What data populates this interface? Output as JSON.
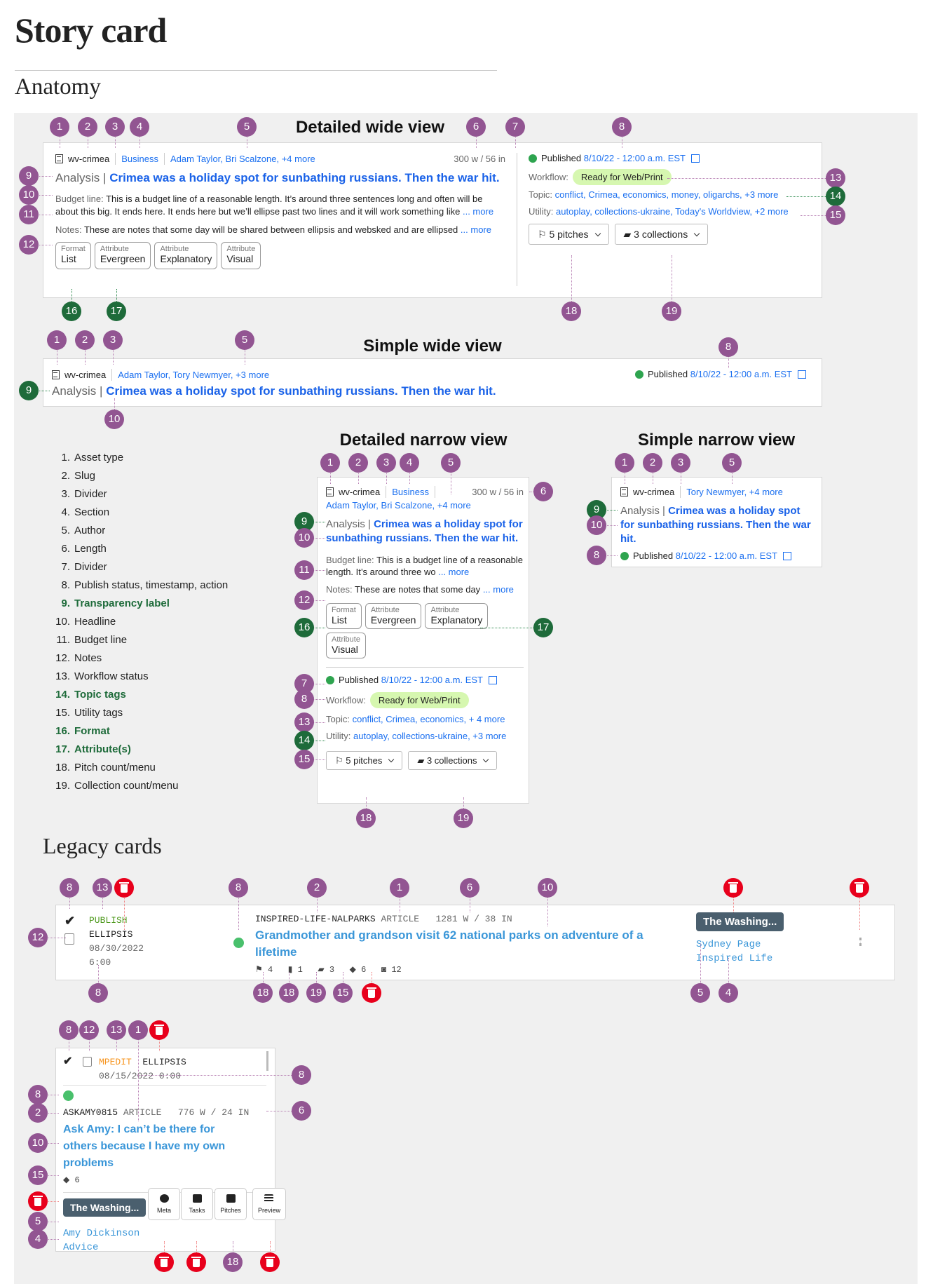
{
  "page": {
    "title": "Story card",
    "section_anatomy": "Anatomy",
    "section_legacy": "Legacy cards"
  },
  "colors": {
    "badge": "#925592",
    "badge_highlight": "#1e6b3a",
    "badge_delete": "#e8001c",
    "link": "#1a6ff0",
    "workflow_pill": "#d6f7b0",
    "published_dot": "#2ea44f"
  },
  "detailed_wide": {
    "heading": "Detailed wide view",
    "slug": "wv-crimea",
    "section": "Business",
    "authors": "Adam Taylor, Bri Scalzone, +4 more",
    "length": "300 w / 56 in",
    "label": "Analysis |",
    "headline": "Crimea was a holiday spot for sunbathing russians. Then the war hit.",
    "budget_label": "Budget line:",
    "budget_text": "This is a budget line of a reasonable length. It’s around three sentences long and often will be about this big. It ends here. It ends here but we’ll ellipse past two lines and it will work something like",
    "more": "... more",
    "notes_label": "Notes:",
    "notes_text": "These are notes that some day will be shared between ellipsis and websked and are ellipsed",
    "chips": [
      {
        "k": "Format",
        "v": "List"
      },
      {
        "k": "Attribute",
        "v": "Evergreen"
      },
      {
        "k": "Attribute",
        "v": "Explanatory"
      },
      {
        "k": "Attribute",
        "v": "Visual"
      }
    ],
    "status": "Published",
    "timestamp": "8/10/22 - 12:00 a.m. EST",
    "workflow_label": "Workflow:",
    "workflow": "Ready for Web/Print",
    "topic_label": "Topic:",
    "topics": "conflict, Crimea, economics, money, oligarchs, +3 more",
    "utility_label": "Utility:",
    "utilities": "autoplay, collections-ukraine, Today's Worldview, +2 more",
    "pitches": "5 pitches",
    "collections": "3 collections"
  },
  "simple_wide": {
    "heading": "Simple wide view",
    "slug": "wv-crimea",
    "authors": "Adam Taylor, Tory Newmyer, +3 more",
    "label": "Analysis |",
    "headline": "Crimea was a holiday spot for sunbathing russians. Then the war hit.",
    "status": "Published",
    "timestamp": "8/10/22 - 12:00 a.m. EST"
  },
  "detailed_narrow": {
    "heading": "Detailed narrow view",
    "slug": "wv-crimea",
    "section": "Business",
    "length": "300 w / 56 in",
    "authors": "Adam Taylor, Bri Scalzone, +4 more",
    "label": "Analysis |",
    "headline": "Crimea was a holiday spot for sunbathing russians. Then the war hit.",
    "budget_label": "Budget line:",
    "budget_text": "This is a budget line of a reasonable length. It’s around three wo",
    "more": "... more",
    "notes_label": "Notes:",
    "notes_text": "These are notes that some day",
    "chips": [
      {
        "k": "Format",
        "v": "List"
      },
      {
        "k": "Attribute",
        "v": "Evergreen"
      },
      {
        "k": "Attribute",
        "v": "Explanatory"
      },
      {
        "k": "Attribute",
        "v": "Visual"
      }
    ],
    "status": "Published",
    "timestamp": "8/10/22 - 12:00 a.m. EST",
    "workflow_label": "Workflow:",
    "workflow": "Ready for Web/Print",
    "topic_label": "Topic:",
    "topics": "conflict, Crimea, economics, + 4 more",
    "utility_label": "Utility:",
    "utilities": "autoplay, collections-ukraine, +3 more",
    "pitches": "5 pitches",
    "collections": "3 collections"
  },
  "simple_narrow": {
    "heading": "Simple narrow view",
    "slug": "wv-crimea",
    "authors": "Tory Newmyer, +4 more",
    "label": "Analysis |",
    "headline": "Crimea was a holiday spot for sunbathing russians. Then the war hit.",
    "status": "Published",
    "timestamp": "8/10/22 - 12:00 a.m. EST"
  },
  "legend": [
    {
      "n": "1.",
      "label": "Asset type",
      "highlight": false
    },
    {
      "n": "2.",
      "label": "Slug",
      "highlight": false
    },
    {
      "n": "3.",
      "label": "Divider",
      "highlight": false
    },
    {
      "n": "4.",
      "label": "Section",
      "highlight": false
    },
    {
      "n": "5.",
      "label": "Author",
      "highlight": false
    },
    {
      "n": "6.",
      "label": "Length",
      "highlight": false
    },
    {
      "n": "7.",
      "label": "Divider",
      "highlight": false
    },
    {
      "n": "8.",
      "label": "Publish status, timestamp, action",
      "highlight": false
    },
    {
      "n": "9.",
      "label": "Transparency label",
      "highlight": true
    },
    {
      "n": "10.",
      "label": "Headline",
      "highlight": false
    },
    {
      "n": "11.",
      "label": "Budget line",
      "highlight": false
    },
    {
      "n": "12.",
      "label": "Notes",
      "highlight": false
    },
    {
      "n": "13.",
      "label": "Workflow status",
      "highlight": false
    },
    {
      "n": "14.",
      "label": "Topic tags",
      "highlight": true
    },
    {
      "n": "15.",
      "label": "Utility tags",
      "highlight": false
    },
    {
      "n": "16.",
      "label": "Format",
      "highlight": true
    },
    {
      "n": "17.",
      "label": "Attribute(s)",
      "highlight": true
    },
    {
      "n": "18.",
      "label": "Pitch count/menu",
      "highlight": false
    },
    {
      "n": "19.",
      "label": "Collection count/menu",
      "highlight": false
    }
  ],
  "legacy_wide": {
    "status": "PUBLISH",
    "system": "ELLIPSIS",
    "date": "08/30/2022",
    "time": "6:00",
    "slug": "INSPIRED-LIFE-NALPARKS",
    "type": "ARTICLE",
    "length": "1281 W / 38 IN",
    "headline": "Grandmother and grandson visit 62 national parks on adventure of a lifetime",
    "counts": {
      "pitches": "4",
      "budgets": "1",
      "collections": "3",
      "tags": "6",
      "photos": "12"
    },
    "publication": "The Washing...",
    "author": "Sydney Page",
    "section": "Inspired Life"
  },
  "legacy_narrow": {
    "status": "MPEDIT",
    "system": "ELLIPSIS",
    "datetime": "08/15/2022 0:00",
    "slug": "ASKAMY0815",
    "type": "ARTICLE",
    "length": "776 W / 24 IN",
    "headline": "Ask Amy: I can’t be there for others because I have my own problems",
    "tags": "6",
    "publication": "The Washing...",
    "author": "Amy Dickinson",
    "section": "Advice",
    "buttons": [
      "Meta",
      "Tasks",
      "Pitches",
      "Preview"
    ]
  },
  "badges": [
    "1",
    "2",
    "3",
    "4",
    "5",
    "6",
    "7",
    "8",
    "9",
    "10",
    "11",
    "12",
    "13",
    "14",
    "15",
    "16",
    "17",
    "18",
    "19"
  ]
}
